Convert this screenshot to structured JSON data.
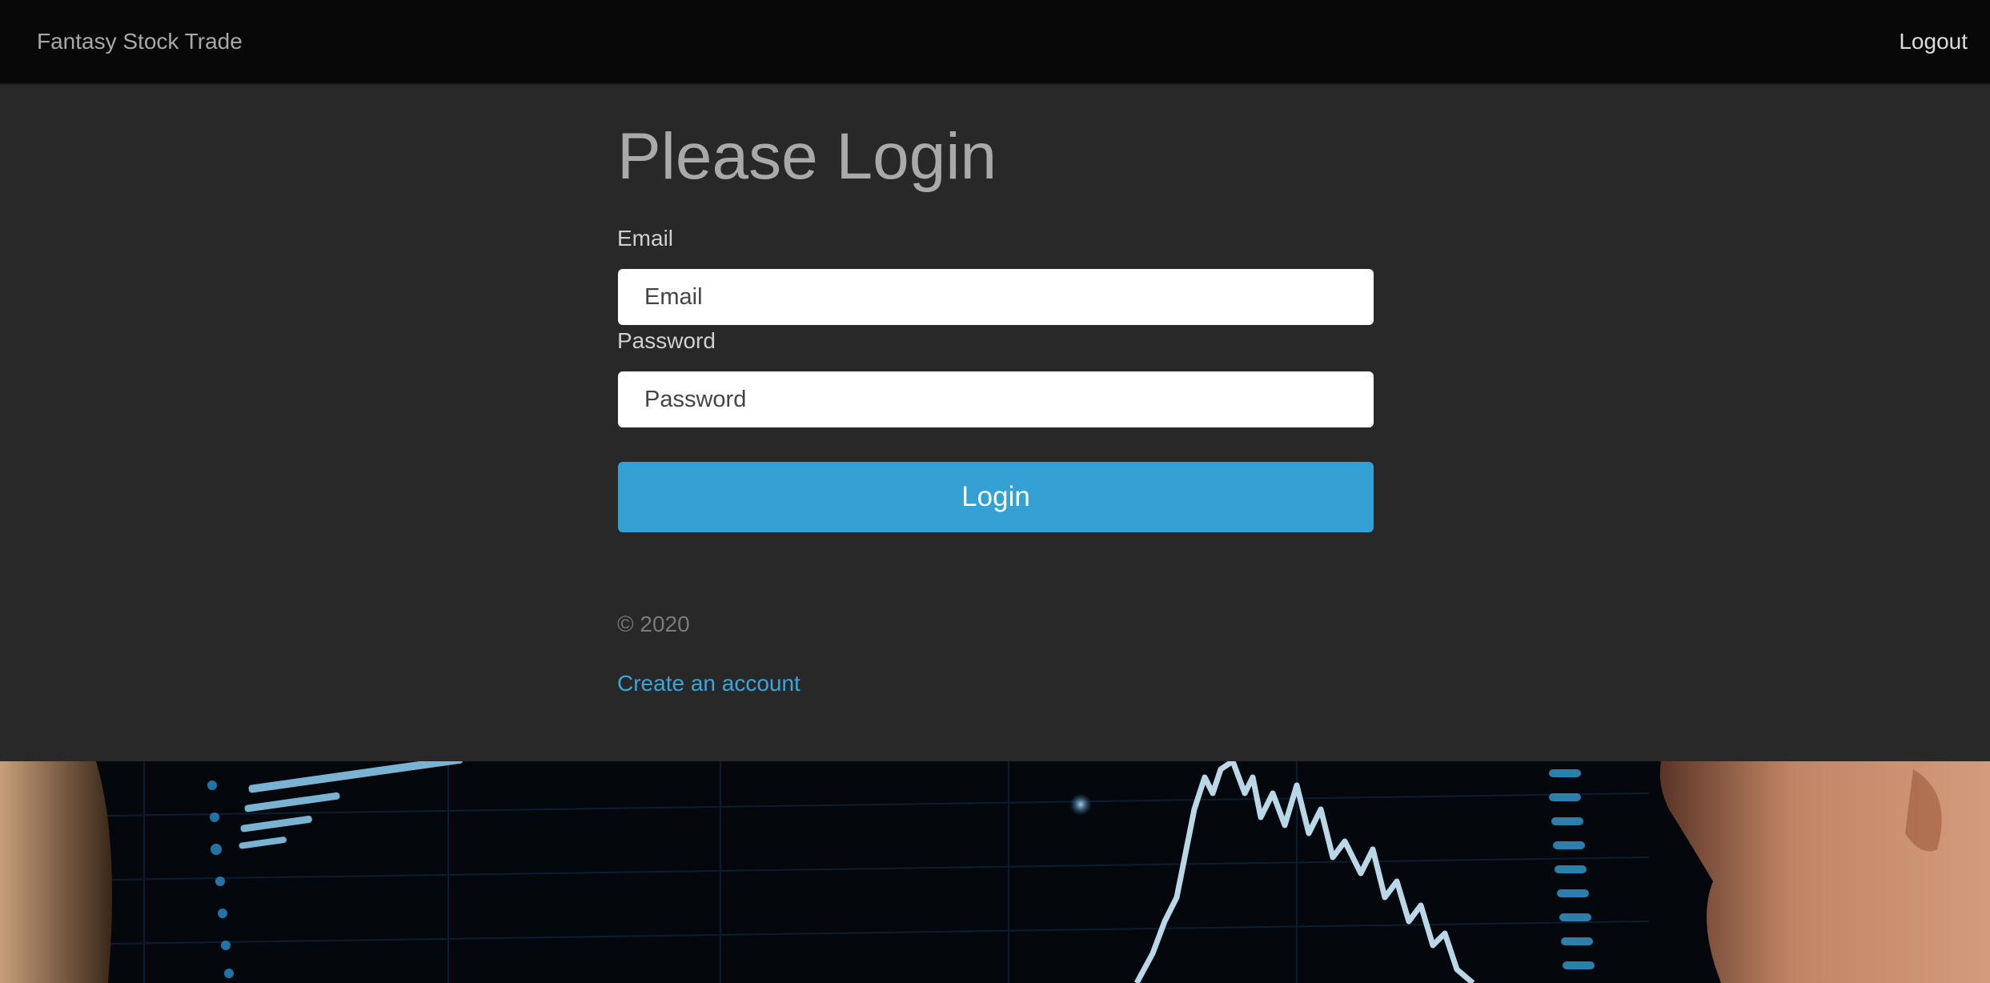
{
  "navbar": {
    "brand": "Fantasy Stock Trade",
    "logout_label": "Logout"
  },
  "login_form": {
    "title": "Please Login",
    "email_label": "Email",
    "email_placeholder": "Email",
    "email_value": "",
    "password_label": "Password",
    "password_placeholder": "Password",
    "password_value": "",
    "submit_label": "Login"
  },
  "footer": {
    "copyright": "© 2020",
    "create_account_label": "Create an account"
  },
  "colors": {
    "navbar_bg": "#080808",
    "panel_bg": "#282828",
    "button_bg": "#35a0d4",
    "link": "#3aa5d8"
  },
  "hero_image": {
    "icon": "stock-chart-photo"
  }
}
